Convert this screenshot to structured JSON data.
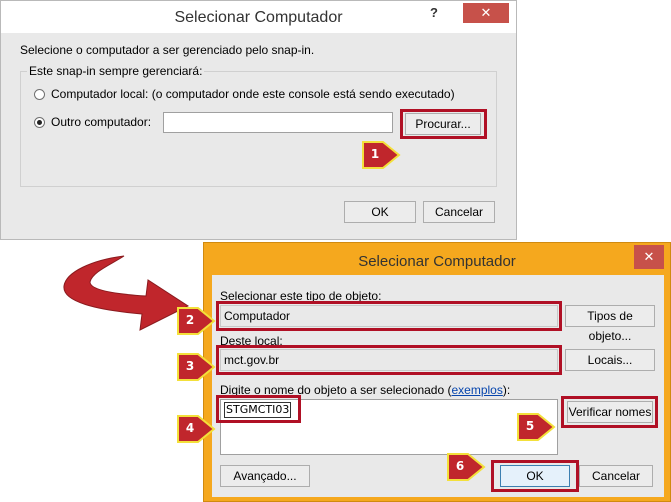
{
  "dialog1": {
    "title": "Selecionar Computador",
    "help_label": "?",
    "close_label": "✕",
    "instruction": "Selecione o computador a ser gerenciado pelo snap-in.",
    "group_label": "Este snap-in sempre gerenciará:",
    "radio_local_label": "Computador local: (o computador onde este console está sendo executado)",
    "radio_other_label": "Outro computador:",
    "other_computer_value": "",
    "browse_button": "Procurar...",
    "ok_button": "OK",
    "cancel_button": "Cancelar"
  },
  "dialog2": {
    "title": "Selecionar Computador",
    "close_label": "✕",
    "object_type_label": "Selecionar este tipo de objeto:",
    "object_type_value": "Computador",
    "object_types_button": "Tipos de objeto...",
    "location_label": "Deste local:",
    "location_value": "mct.gov.br",
    "locations_button": "Locais...",
    "enter_name_label": "Digite o nome do objeto a ser selecionado (",
    "examples_link": "exemplos",
    "enter_name_suffix": "):",
    "object_name_value": "STGMCTI03",
    "check_names_button": "Verificar nomes",
    "advanced_button": "Avançado...",
    "ok_button": "OK",
    "cancel_button": "Cancelar"
  },
  "step_badges": [
    "1",
    "2",
    "3",
    "4",
    "5",
    "6"
  ],
  "colors": {
    "highlight": "#b01025",
    "arrow": "#c0262c",
    "badge": "#c0262c",
    "badge_outline": "#f3e03a",
    "dialog2_frame": "#f5a81e"
  }
}
